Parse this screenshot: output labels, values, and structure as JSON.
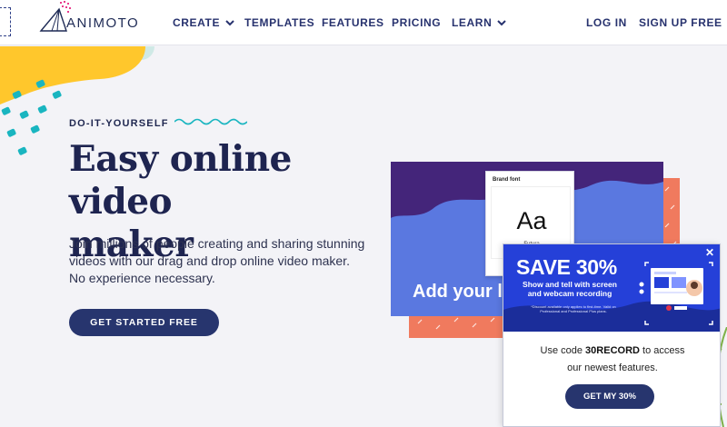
{
  "header": {
    "logo_text": "ANIMOTO",
    "nav": [
      {
        "label": "CREATE",
        "has_dropdown": true
      },
      {
        "label": "TEMPLATES",
        "has_dropdown": false
      },
      {
        "label": "FEATURES",
        "has_dropdown": false
      },
      {
        "label": "PRICING",
        "has_dropdown": false
      },
      {
        "label": "LEARN",
        "has_dropdown": true
      }
    ],
    "login_label": "LOG IN",
    "signup_label": "SIGN UP FREE"
  },
  "hero": {
    "eyebrow": "DO-IT-YOURSELF",
    "title_line1": "Easy online video",
    "title_line2": "maker",
    "description": "Join millions of people creating and sharing stunning videos with our drag and drop online video maker. No experience necessary.",
    "cta_label": "GET STARTED FREE"
  },
  "illustration": {
    "brand_font_label": "Brand font",
    "sample_glyphs": "Aa",
    "font_name": "Futura",
    "overlay_text": "Add your l"
  },
  "promo": {
    "headline": "SAVE 30%",
    "subline": "Show and tell with screen and webcam recording",
    "fine_print": "*Discount available only applies to first-time. Valid on Professional and Professional Plus plans.",
    "message_prefix": "Use code",
    "code": "30RECORD",
    "message_suffix": "to access",
    "message_line2": "our newest features.",
    "cta_label": "GET MY 30%",
    "close_symbol": "✕"
  },
  "colors": {
    "navy": "#27356e",
    "blue": "#2540d8",
    "periwinkle": "#5a78e0",
    "purple": "#44257a",
    "coral": "#f07a5e",
    "yellow": "#ffc72c",
    "teal": "#19b5c0"
  }
}
